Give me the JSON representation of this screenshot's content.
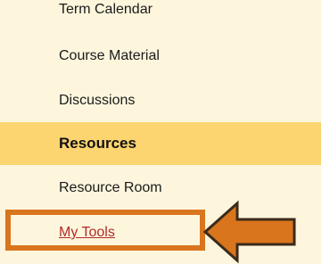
{
  "nav": {
    "items": [
      {
        "label": "Term Calendar"
      },
      {
        "label": "Course Material"
      },
      {
        "label": "Discussions"
      },
      {
        "label": "Resources"
      },
      {
        "label": "Resource Room"
      },
      {
        "label": "My Tools"
      }
    ]
  },
  "colors": {
    "sidebar_bg": "#fdf6dd",
    "active_bg": "#fcd571",
    "link_red": "#b52a2a",
    "annotation_orange": "#d9751d"
  },
  "annotation": {
    "icon": "left-arrow-icon"
  }
}
